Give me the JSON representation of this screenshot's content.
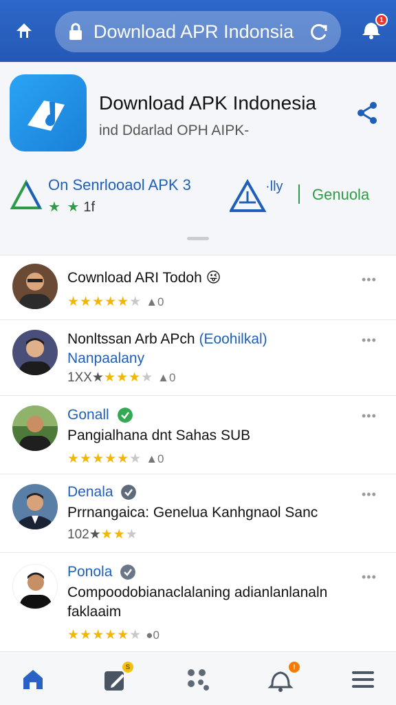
{
  "browser": {
    "url_text": "Download APR Indonsia",
    "notification_count": "1",
    "icons": {
      "back": "back-arrow-icon",
      "lock": "lock-icon",
      "reload": "reload-icon",
      "notification": "notification-bell-icon"
    }
  },
  "app": {
    "title": "Download APK Indonesia",
    "subtitle": "ind Ddarlad OPH AIPK-",
    "meta_title": "On Senrlooaol APK 3",
    "meta_stars": "★ ★",
    "meta_count": "1f",
    "warn_text": "·lly",
    "meta_link": "Genuola",
    "accent_color": "#2558b6",
    "green_color": "#2e9c44"
  },
  "reviews": [
    {
      "name": "Cownload ARI Todoh",
      "emoji": "😜",
      "stars": "★★★★★",
      "empty": "★",
      "count": "0",
      "avatar_bg": "#6b4a35"
    },
    {
      "name": "Nonltssan Arb APch",
      "tag": "(Eoohilkal)",
      "line1": "Nanpaalany",
      "prefix": "1XX★",
      "stars": "★★★",
      "empty": "★",
      "count": "0",
      "avatar_bg": "#4a4f7a"
    },
    {
      "name": "Gonall",
      "line1": "Pangialhana dnt Sahas SUB",
      "stars": "★★★★★",
      "empty": "★",
      "count": "0",
      "avatar_bg": "#4d7a3a"
    },
    {
      "name": "Denala",
      "line1": "Prrnangaica: Genelua Kanhgnaol Sanc",
      "prefix": "102★",
      "stars": "★★",
      "empty": "★",
      "avatar_bg": "#5a7fa6"
    },
    {
      "name": "Ponola",
      "line1": "Compoodobianaclalaning adianlanlanaln",
      "line2": "faklaaim",
      "stars": "★★★★★",
      "empty": "★",
      "count": "0",
      "avatar_bg": "#ffffff"
    }
  ],
  "bottom_nav": {
    "edit_badge": "S",
    "alerts_badge": "!",
    "items": [
      "home-icon",
      "edit-icon",
      "apps-icon",
      "alerts-icon",
      "menu-icon"
    ]
  }
}
